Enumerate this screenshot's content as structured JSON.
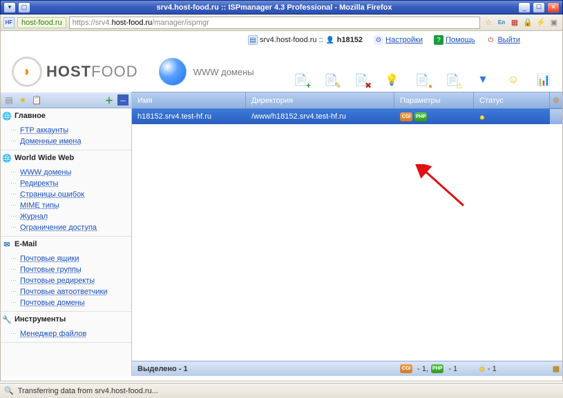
{
  "window": {
    "title": "srv4.host-food.ru :: ISPmanager 4.3 Professional - Mozilla Firefox"
  },
  "addressbar": {
    "favicon_text": "HF",
    "origin": "host-food.ru",
    "proto": "https://",
    "greyhost": "srv4.",
    "blackhost": "host-food.ru",
    "path": "/manager/ispmgr"
  },
  "header": {
    "srv_label": "srv4.host-food.ru ::",
    "user": "h18152",
    "settings": "Настройки",
    "help": "Помощь",
    "exit": "Выйти"
  },
  "brand": {
    "b1": "HOST",
    "b2": "FOOD"
  },
  "section_title": "WWW домены",
  "sidebar": {
    "sections": [
      {
        "label": "Главное",
        "items": [
          "FTP аккаунты",
          "Доменные имена"
        ],
        "icon": "🌐",
        "icolor": "#c08a2a"
      },
      {
        "label": "World Wide Web",
        "items": [
          "WWW домены",
          "Редиректы",
          "Страницы ошибок",
          "MIME типы",
          "Журнал",
          "Ограничение доступа"
        ],
        "icon": "🌐",
        "icolor": "#2a7ac0"
      },
      {
        "label": "E-Mail",
        "items": [
          "Почтовые ящики",
          "Почтовые группы",
          "Почтовые редиректы",
          "Почтовые автоответчики",
          "Почтовые домены"
        ],
        "icon": "✉",
        "icolor": "#3a7ac0"
      },
      {
        "label": "Инструменты",
        "items": [
          "Менеджер файлов"
        ],
        "icon": "🔧",
        "icolor": "#b87a2a"
      }
    ]
  },
  "columns": {
    "name": "Имя",
    "dir": "Директория",
    "par": "Параметры",
    "stat": "Статус"
  },
  "row": {
    "name": "h18152.srv4.test-hf.ru",
    "dir": "/www/h18152.srv4.test-hf.ru",
    "badge1": "CGI",
    "badge2": "PHP"
  },
  "footer": {
    "selected": "Выделено - 1",
    "par": "- 1,",
    "par2": "- 1",
    "stat": "- 1"
  },
  "status": "Transferring data from srv4.host-food.ru..."
}
